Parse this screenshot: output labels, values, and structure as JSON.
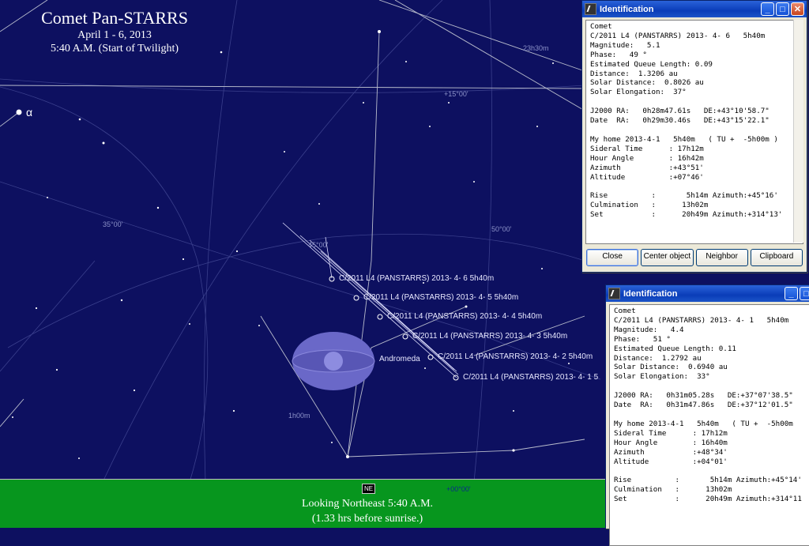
{
  "sky": {
    "title": "Comet Pan-STARRS",
    "subtitle1": "April 1 - 6, 2013",
    "subtitle2": "5:40 A.M. (Start of Twilight)",
    "grid_labels": [
      "23h30m",
      "+15°00'",
      "35°00'",
      "45°00'",
      "50°00'",
      "1h00m",
      "+00°00'"
    ],
    "alpha": "α",
    "andromeda": "Andromeda",
    "comet_labels": [
      "C/2011 L4 (PANSTARRS) 2013- 4- 6   5h40m",
      "C/2011 L4 (PANSTARRS) 2013- 4- 5   5h40m",
      "C/2011 L4 (PANSTARRS) 2013- 4- 4   5h40m",
      "C/2011 L4 (PANSTARRS) 2013- 4- 3   5h40m",
      "C/2011 L4 (PANSTARRS) 2013- 4- 2   5h40m",
      "C/2011 L4 (PANSTARRS) 2013- 4- 1   5"
    ],
    "ne_marker": "NE",
    "ground_line1": "Looking Northeast 5:40 A.M.",
    "ground_line2": "(1.33 hrs before sunrise.)"
  },
  "colors": {
    "sky": "#0d1060",
    "ground": "#07961e",
    "andromeda": "#6a68c8"
  },
  "window1": {
    "title": "Identification",
    "text": "Comet\nC/2011 L4 (PANSTARRS) 2013- 4- 6   5h40m\nMagnitude:   5.1\nPhase:   49 °\nEstimated Queue Length: 0.09\nDistance:  1.3206 au\nSolar Distance:  0.8026 au\nSolar Elongation:  37°\n\nJ2000 RA:   0h28m47.61s   DE:+43°10'58.7\"\nDate  RA:   0h29m30.46s   DE:+43°15'22.1\"\n\nMy home 2013-4-1   5h40m   ( TU +  -5h00m )\nSideral Time      : 17h12m\nHour Angle        : 16h42m\nAzimuth           :+43°51'\nAltitude          :+07°46'\n\nRise          :       5h14m Azimuth:+45°16'\nCulmination   :      13h02m\nSet           :      20h49m Azimuth:+314°13'",
    "buttons": [
      "Close",
      "Center object",
      "Neighbor",
      "Clipboard"
    ]
  },
  "window2": {
    "title": "Identification",
    "text": "Comet\nC/2011 L4 (PANSTARRS) 2013- 4- 1   5h40m\nMagnitude:   4.4\nPhase:   51 °\nEstimated Queue Length: 0.11\nDistance:  1.2792 au\nSolar Distance:  0.6940 au\nSolar Elongation:  33°\n\nJ2000 RA:   0h31m05.28s   DE:+37°07'38.5\"\nDate  RA:   0h31m47.86s   DE:+37°12'01.5\"\n\nMy home 2013-4-1   5h40m   ( TU +  -5h00m\nSideral Time      : 17h12m\nHour Angle        : 16h40m\nAzimuth           :+48°34'\nAltitude          :+04°01'\n\nRise          :       5h14m Azimuth:+45°14'\nCulmination   :      13h02m\nSet           :      20h49m Azimuth:+314°11"
  }
}
